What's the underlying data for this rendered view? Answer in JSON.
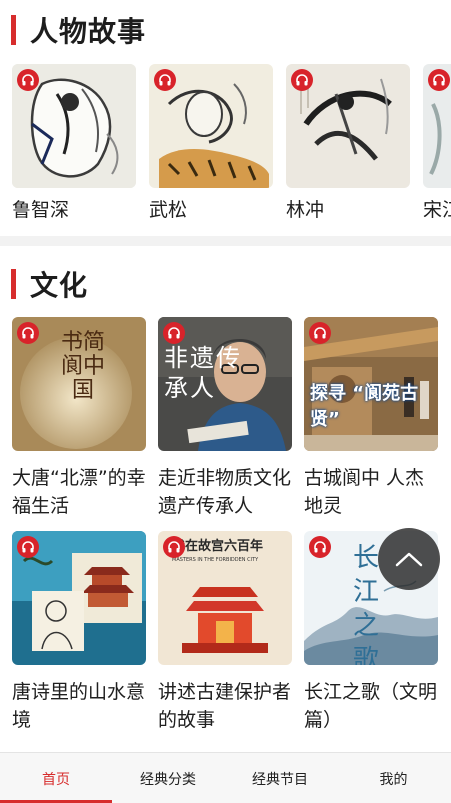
{
  "sections": {
    "characters": {
      "title": "人物故事",
      "items": [
        {
          "label": "鲁智深"
        },
        {
          "label": "武松"
        },
        {
          "label": "林冲"
        },
        {
          "label": "宋江"
        }
      ]
    },
    "culture": {
      "title": "文化",
      "items": [
        {
          "label": "大唐“北漂”的幸福生活",
          "overlay": "书简阆中国"
        },
        {
          "label": "走近非物质文化遗产传承人",
          "overlay": "非遗传承人"
        },
        {
          "label": "古城阆中 人杰地灵",
          "overlay": "探寻 “阆苑古贤”"
        },
        {
          "label": "唐诗里的山水意境",
          "overlay": ""
        },
        {
          "label": "讲述古建保护者的故事",
          "overlay": "我在故宫六百年",
          "overlay_sub": "MASTERS IN THE FORBIDDEN CITY"
        },
        {
          "label": "长江之歌（文明篇）",
          "overlay": "长江之歌"
        }
      ]
    }
  },
  "icons": {
    "audio_badge": "headphones-icon",
    "scroll_top": "chevron-up-icon"
  },
  "tabbar": {
    "tabs": [
      {
        "label": "首页",
        "active": true
      },
      {
        "label": "经典分类",
        "active": false
      },
      {
        "label": "经典节目",
        "active": false
      },
      {
        "label": "我的",
        "active": false
      }
    ]
  },
  "colors": {
    "accent": "#d72d2d",
    "badge": "#d8232a"
  }
}
